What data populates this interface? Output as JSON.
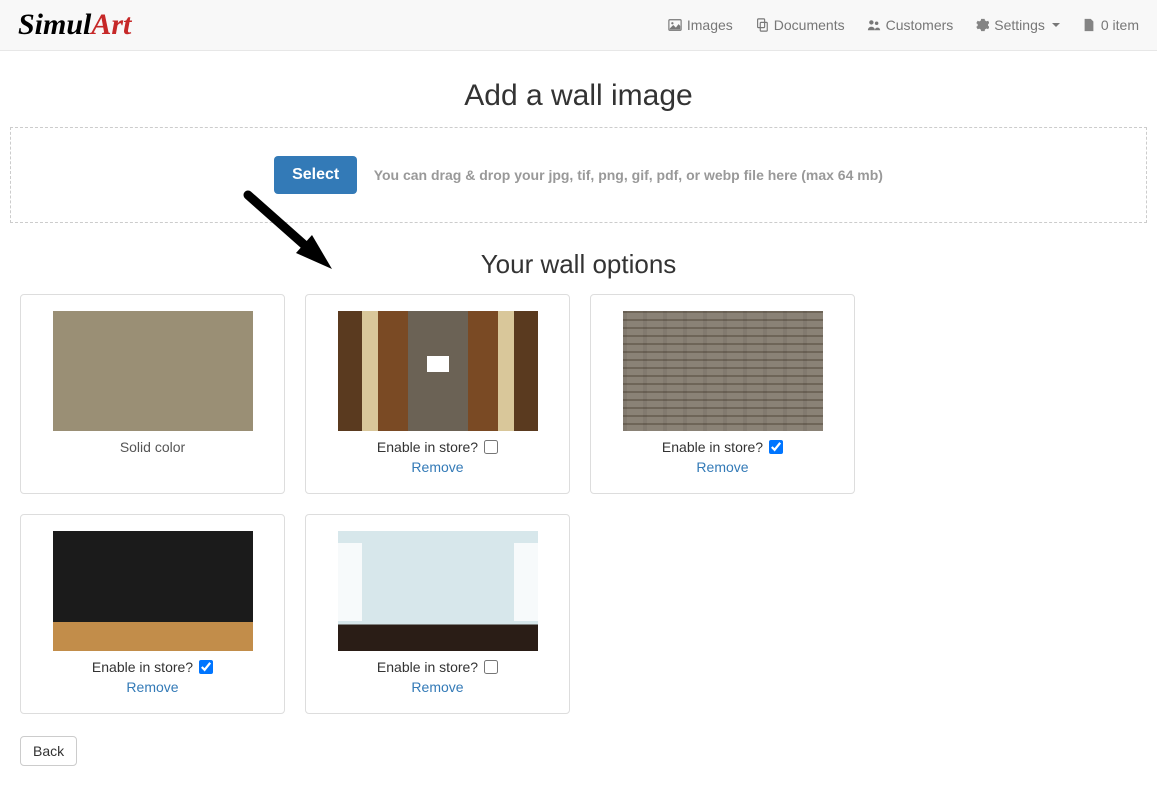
{
  "brand": {
    "first": "Simul",
    "accent": "Art"
  },
  "nav": {
    "images": "Images",
    "documents": "Documents",
    "customers": "Customers",
    "settings": "Settings",
    "cart": "0 item"
  },
  "page": {
    "title": "Add a wall image",
    "upload": {
      "select_label": "Select",
      "hint": "You can drag & drop your jpg, tif, png, gif, pdf, or webp file here (max 64 mb)"
    },
    "section_title": "Your wall options",
    "enable_label": "Enable in store?",
    "remove_label": "Remove",
    "options": [
      {
        "label": "Solid color",
        "has_enable": false,
        "enabled": false
      },
      {
        "label": "",
        "has_enable": true,
        "enabled": false
      },
      {
        "label": "",
        "has_enable": true,
        "enabled": true
      },
      {
        "label": "",
        "has_enable": true,
        "enabled": true
      },
      {
        "label": "",
        "has_enable": true,
        "enabled": false
      }
    ],
    "back_label": "Back"
  }
}
